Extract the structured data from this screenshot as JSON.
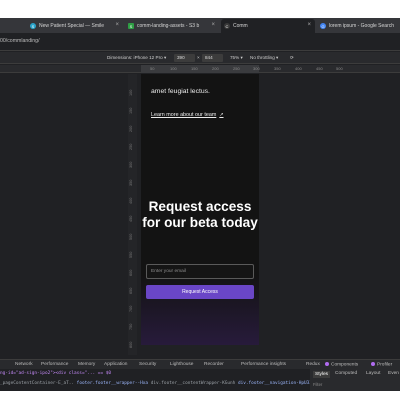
{
  "browser": {
    "tabs": [
      {
        "title": "New Patient Special — Smile",
        "favicon_color": "#2aa3c9",
        "favicon_char": "S"
      },
      {
        "title": "comm-landing-assets - S3 b",
        "favicon_color": "#2e9e44",
        "favicon_char": "S"
      },
      {
        "title": "Comm",
        "favicon_color": "#3a3a3a",
        "favicon_char": "C"
      },
      {
        "title": "lorem ipsum - Google Search",
        "favicon_color": "#4285f4",
        "favicon_char": "G"
      }
    ],
    "url": "00/commlanding/"
  },
  "device_toolbar": {
    "dimensions_label": "Dimensions: iPhone 12 Pro ▾",
    "width": "390",
    "times": "×",
    "height": "844",
    "zoom": "75% ▾",
    "throttling": "No throttling ▾"
  },
  "ruler": {
    "ticks": [
      "50",
      "100",
      "150",
      "200",
      "250",
      "300",
      "350",
      "400",
      "450",
      "500"
    ],
    "vticks": [
      "100",
      "150",
      "200",
      "250",
      "300",
      "350",
      "400",
      "450",
      "500",
      "550",
      "600",
      "650",
      "700",
      "750",
      "800"
    ]
  },
  "page": {
    "lede": "amet feugiat lectus.",
    "learn_more": "Learn more about our team",
    "external_icon": "↗",
    "headline": "Request access for our beta today",
    "email_placeholder": "Enter your email",
    "cta_label": "Request Access"
  },
  "devtools": {
    "tabs": [
      "Network",
      "Performance",
      "Memory",
      "Application",
      "Security",
      "Lighthouse",
      "Recorder",
      "Performance insights",
      "Redux",
      "Components",
      "Profiler"
    ],
    "crumb_line1": "ng-id=\"ad-sign-ipo2\"><div class=\"... == $0",
    "crumbs": [
      "_pageContentContainer-E_aT..",
      "footer.footer__wrapper--Hxa",
      "div.footer__contentWrapper-KGunh",
      "div.footer__navigation-HpU3Z"
    ],
    "side_tabs": [
      "Styles",
      "Computed",
      "Layout",
      "Even"
    ],
    "filter": "Filter"
  },
  "colors": {
    "accent": "#6a46c7",
    "page_bg": "#131313"
  }
}
